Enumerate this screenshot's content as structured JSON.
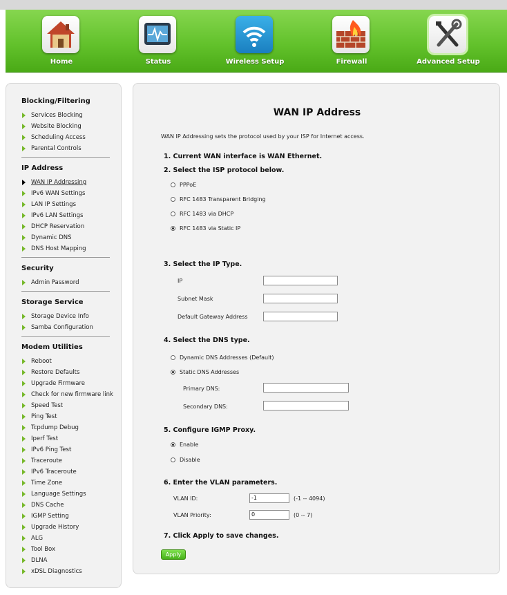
{
  "nav": {
    "items": [
      {
        "label": "Home",
        "icon": "home-icon"
      },
      {
        "label": "Status",
        "icon": "status-icon"
      },
      {
        "label": "Wireless Setup",
        "icon": "wireless-icon"
      },
      {
        "label": "Firewall",
        "icon": "firewall-icon"
      },
      {
        "label": "Advanced Setup",
        "icon": "tools-icon",
        "active": true
      }
    ]
  },
  "sidebar": {
    "sections": [
      {
        "title": "Blocking/Filtering",
        "items": [
          "Services Blocking",
          "Website Blocking",
          "Scheduling Access",
          "Parental Controls"
        ]
      },
      {
        "title": "IP Address",
        "items": [
          "WAN IP Addressing",
          "IPv6 WAN Settings",
          "LAN IP Settings",
          "IPv6 LAN Settings",
          "DHCP Reservation",
          "Dynamic DNS",
          "DNS Host Mapping"
        ]
      },
      {
        "title": "Security",
        "items": [
          "Admin Password"
        ]
      },
      {
        "title": "Storage Service",
        "items": [
          "Storage Device Info",
          "Samba Configuration"
        ]
      },
      {
        "title": "Modem Utilities",
        "items": [
          "Reboot",
          "Restore Defaults",
          "Upgrade Firmware",
          "Check for new firmware link",
          "Speed Test",
          "Ping Test",
          "Tcpdump Debug",
          "Iperf Test",
          "IPv6 Ping Test",
          "Traceroute",
          "IPv6 Traceroute",
          "Time Zone",
          "Language Settings",
          "DNS Cache",
          "IGMP Setting",
          "Upgrade History",
          "ALG",
          "Tool Box",
          "DLNA",
          "xDSL Diagnostics"
        ]
      }
    ],
    "active_item": "WAN IP Addressing"
  },
  "main": {
    "title": "WAN IP Address",
    "description": "WAN IP Addressing sets the protocol used by your ISP for Internet access.",
    "step1": "1. Current WAN interface is WAN Ethernet.",
    "step2": "2. Select the ISP protocol below.",
    "protocols": [
      "PPPoE",
      "RFC 1483 Transparent Bridging",
      "RFC 1483 via DHCP",
      "RFC 1483 via Static IP"
    ],
    "protocol_selected": "RFC 1483 via Static IP",
    "step3": "3. Select the IP Type.",
    "ip_label": "IP",
    "ip_value": "",
    "subnet_label": "Subnet Mask",
    "subnet_value": "",
    "gateway_label": "Default Gateway Address",
    "gateway_value": "",
    "step4": "4. Select the DNS type.",
    "dns_options": [
      "Dynamic DNS Addresses (Default)",
      "Static DNS Addresses"
    ],
    "dns_selected": "Static DNS Addresses",
    "primary_dns_label": "Primary DNS:",
    "primary_dns_value": "",
    "secondary_dns_label": "Secondary DNS:",
    "secondary_dns_value": "",
    "step5": "5. Configure IGMP Proxy.",
    "igmp_options": [
      "Enable",
      "Disable"
    ],
    "igmp_selected": "Enable",
    "step6": "6. Enter the VLAN parameters.",
    "vlan_id_label": "VLAN ID:",
    "vlan_id_value": "-1",
    "vlan_id_range": "(-1 -- 4094)",
    "vlan_priority_label": "VLAN Priority:",
    "vlan_priority_value": "0",
    "vlan_priority_range": "(0 -- 7)",
    "step7": "7. Click Apply to save changes.",
    "apply_label": "Apply"
  },
  "colors": {
    "nav_green": "#63c22c",
    "accent_arrow": "#76b82a",
    "panel_bg": "#f2f2f2"
  }
}
